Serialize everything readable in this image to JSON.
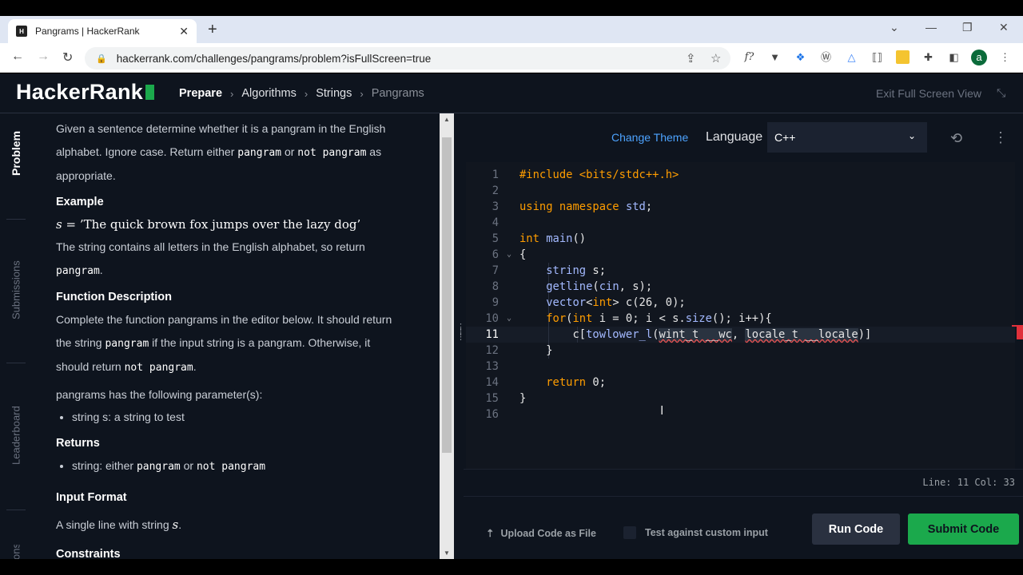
{
  "browser": {
    "tab_title": "Pangrams | HackerRank",
    "tab_favicon_text": "H",
    "new_tab": "+",
    "close_tab": "✕",
    "url": "hackerrank.com/challenges/pangrams/problem?isFullScreen=true",
    "profile_initial": "a"
  },
  "header": {
    "logo_text": "HackerRank",
    "breadcrumbs": [
      "Prepare",
      "Algorithms",
      "Strings",
      "Pangrams"
    ],
    "exit_fullscreen": "Exit Full Screen View"
  },
  "sidebar": {
    "items": [
      "Problem",
      "Submissions",
      "Leaderboard",
      "Discussions"
    ],
    "last_visible": "ons"
  },
  "problem": {
    "intro_1": "Given a sentence determine whether it is a pangram in the English",
    "intro_2a": "alphabet. Ignore case. Return either ",
    "intro_code1": "pangram",
    "intro_2b": " or ",
    "intro_code2": "not pangram",
    "intro_2c": " as",
    "intro_3": "appropriate.",
    "example_heading": "Example",
    "example_var": "s",
    "example_eq": " = ",
    "example_value": "’The quick brown fox jumps over the lazy dog’",
    "example_text": "The string contains all letters in the English alphabet, so return",
    "example_code": "pangram",
    "example_end": ".",
    "fd_heading": "Function Description",
    "fd_1": "Complete the function pangrams in the editor below. It should return",
    "fd_2a": "the string ",
    "fd_code1": "pangram",
    "fd_2b": " if the input string is a pangram. Otherwise, it",
    "fd_3a": "should return ",
    "fd_code2": "not pangram",
    "fd_3b": ".",
    "params_text": "pangrams has the following parameter(s):",
    "param_1": "string s: a string to test",
    "returns_heading": "Returns",
    "returns_a": "string: either ",
    "returns_code1": "pangram",
    "returns_b": " or ",
    "returns_code2": "not pangram",
    "input_heading": "Input Format",
    "input_text": "A single line with string ",
    "input_var": "s",
    "input_end": ".",
    "constraints_heading": "Constraints"
  },
  "editor": {
    "change_theme": "Change Theme",
    "language_label": "Language",
    "language_value": "C++",
    "status": "Line: 11 Col: 33",
    "current_line": 11,
    "lines": [
      "#include <bits/stdc++.h>",
      "",
      "using namespace std;",
      "",
      "int main()",
      "{",
      "    string s;",
      "    getline(cin, s);",
      "    vector<int> c(26, 0);",
      "    for(int i = 0; i < s.size(); i++){",
      "        c[towlower_l(wint_t __wc, locale_t __locale)]",
      "    }",
      "",
      "    return 0;",
      "}",
      ""
    ],
    "line_numbers": [
      "1",
      "2",
      "3",
      "4",
      "5",
      "6",
      "7",
      "8",
      "9",
      "10",
      "11",
      "12",
      "13",
      "14",
      "15",
      "16"
    ]
  },
  "actions": {
    "upload": "Upload Code as File",
    "custom_input": "Test against custom input",
    "run": "Run Code",
    "submit": "Submit Code"
  },
  "colors": {
    "brand_green": "#1ba94c",
    "background": "#0e141e",
    "link_blue": "#4da3ff"
  }
}
